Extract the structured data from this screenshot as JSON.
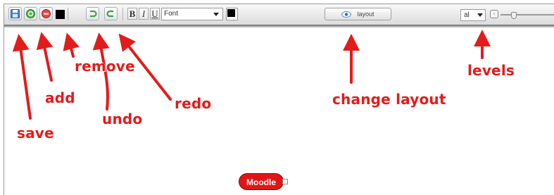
{
  "toolbar": {
    "font_placeholder": "Font",
    "bold_label": "B",
    "italic_label": "I",
    "underline_label": "U",
    "layout_label": "layout",
    "levels_value": "al",
    "zoom_minus_label": "-"
  },
  "annotations": {
    "save": "save",
    "add": "add",
    "remove": "remove",
    "undo": "undo",
    "redo": "redo",
    "change_layout": "change layout",
    "levels": "levels"
  },
  "mindmap": {
    "root_node_label": "Moodle"
  },
  "colors": {
    "annotation": "#e31b1b",
    "node_fill": "#e01616",
    "add_icon": "#3fa43a",
    "remove_icon": "#d63a3a",
    "save_icon": "#3d78c8",
    "undo_redo_icon": "#3da34a"
  },
  "icons": [
    "save-icon",
    "add-icon",
    "remove-icon",
    "undo-icon",
    "redo-icon",
    "eye-icon",
    "chevron-down-icon"
  ]
}
